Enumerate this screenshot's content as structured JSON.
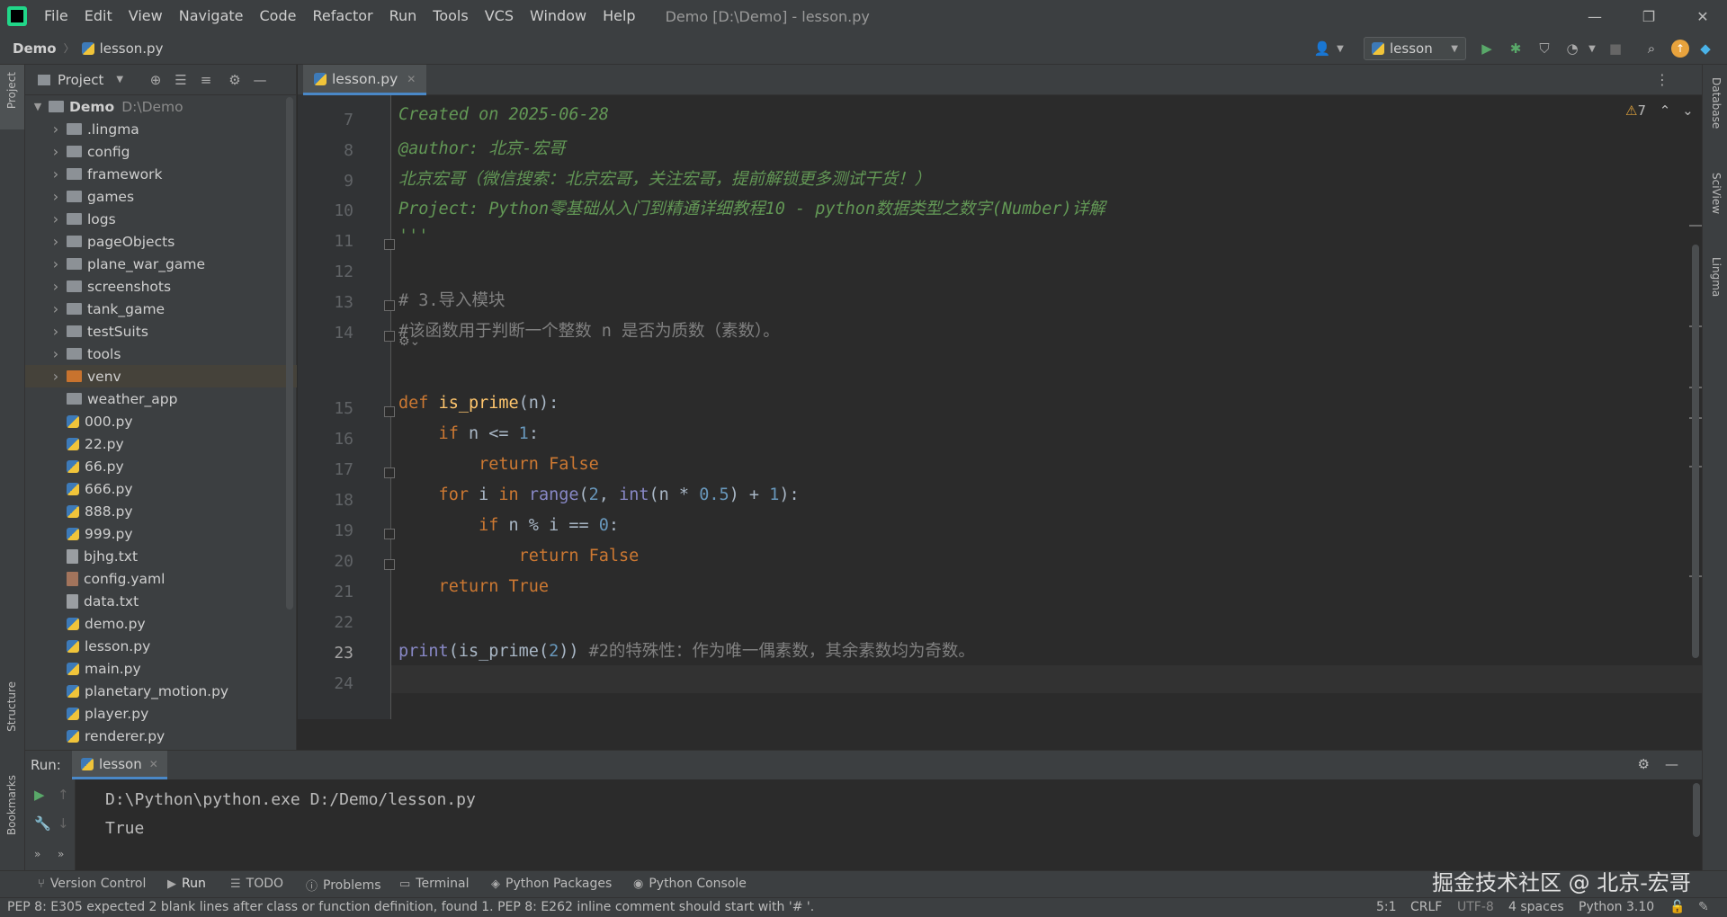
{
  "menubar": {
    "items": [
      "File",
      "Edit",
      "View",
      "Navigate",
      "Code",
      "Refactor",
      "Run",
      "Tools",
      "VCS",
      "Window",
      "Help"
    ],
    "window_title": "Demo [D:\\Demo] - lesson.py"
  },
  "navbar": {
    "crumb_project": "Demo",
    "crumb_file": "lesson.py",
    "run_config": "lesson"
  },
  "left_strip": {
    "project": "Project",
    "structure": "Structure",
    "bookmarks": "Bookmarks"
  },
  "right_strip": {
    "database": "Database",
    "sciview": "SciView",
    "lingma": "Lingma"
  },
  "project_panel": {
    "title": "Project",
    "root_name": "Demo",
    "root_path": "D:\\Demo",
    "items": [
      {
        "name": ".lingma",
        "kind": "folder"
      },
      {
        "name": "config",
        "kind": "folder"
      },
      {
        "name": "framework",
        "kind": "folder"
      },
      {
        "name": "games",
        "kind": "folder"
      },
      {
        "name": "logs",
        "kind": "folder"
      },
      {
        "name": "pageObjects",
        "kind": "folder"
      },
      {
        "name": "plane_war_game",
        "kind": "folder"
      },
      {
        "name": "screenshots",
        "kind": "folder"
      },
      {
        "name": "tank_game",
        "kind": "folder"
      },
      {
        "name": "testSuits",
        "kind": "folder"
      },
      {
        "name": "tools",
        "kind": "folder"
      },
      {
        "name": "venv",
        "kind": "folder-orange"
      },
      {
        "name": "weather_app",
        "kind": "folder-plain"
      },
      {
        "name": "000.py",
        "kind": "py"
      },
      {
        "name": "22.py",
        "kind": "py"
      },
      {
        "name": "66.py",
        "kind": "py"
      },
      {
        "name": "666.py",
        "kind": "py"
      },
      {
        "name": "888.py",
        "kind": "py"
      },
      {
        "name": "999.py",
        "kind": "py"
      },
      {
        "name": "bjhg.txt",
        "kind": "txt"
      },
      {
        "name": "config.yaml",
        "kind": "yml"
      },
      {
        "name": "data.txt",
        "kind": "txt"
      },
      {
        "name": "demo.py",
        "kind": "py"
      },
      {
        "name": "lesson.py",
        "kind": "py"
      },
      {
        "name": "main.py",
        "kind": "py"
      },
      {
        "name": "planetary_motion.py",
        "kind": "py"
      },
      {
        "name": "player.py",
        "kind": "py"
      },
      {
        "name": "renderer.py",
        "kind": "py"
      }
    ]
  },
  "editor": {
    "tab_label": "lesson.py",
    "warning_count": "7",
    "lines": [
      {
        "n": "7",
        "text": "Created on 2025-06-28"
      },
      {
        "n": "8",
        "text": "@author: 北京-宏哥"
      },
      {
        "n": "9",
        "text": "北京宏哥（微信搜索：北京宏哥，关注宏哥，提前解锁更多测试干货！）"
      },
      {
        "n": "10",
        "text": "Project: Python零基础从入门到精通详细教程10 - python数据类型之数字(Number)详解"
      },
      {
        "n": "11",
        "text": "'''"
      },
      {
        "n": "12",
        "text": ""
      },
      {
        "n": "13",
        "text": "# 3.导入模块"
      },
      {
        "n": "14",
        "text": "#该函数用于判断一个整数 n 是否为质数（素数）。"
      },
      {
        "n": "15",
        "k1": "def ",
        "f1": "is_prime",
        "r1": "(n):"
      },
      {
        "n": "16",
        "k1": "    if ",
        "r1": "n <= ",
        "v1": "1",
        "r2": ":"
      },
      {
        "n": "17",
        "k1": "        return False"
      },
      {
        "n": "18",
        "k1": "    for ",
        "r1": "i ",
        "k2": "in ",
        "b1": "range",
        "r2": "(",
        "v1": "2",
        "r3": ", ",
        "b2": "int",
        "r4": "(n * ",
        "v2": "0.5",
        "r5": ") + ",
        "v3": "1",
        "r6": "):"
      },
      {
        "n": "19",
        "k1": "        if ",
        "r1": "n % i == ",
        "v1": "0",
        "r2": ":"
      },
      {
        "n": "20",
        "k1": "            return False"
      },
      {
        "n": "21",
        "k1": "    return True"
      },
      {
        "n": "22",
        "text": ""
      },
      {
        "n": "23",
        "b1": "print",
        "r1": "(is_prime(",
        "v1": "2",
        "r2": ")) ",
        "c1": "#2的特殊性：作为唯一偶素数，其余素数均为奇数。"
      },
      {
        "n": "24",
        "text": ""
      }
    ]
  },
  "run_panel": {
    "label": "Run:",
    "tab": "lesson",
    "output": [
      "D:\\Python\\python.exe D:/Demo/lesson.py",
      "True"
    ]
  },
  "bottom_tabs": [
    "Version Control",
    "Run",
    "TODO",
    "Problems",
    "Terminal",
    "Python Packages",
    "Python Console"
  ],
  "status": {
    "message": "PEP 8: E305 expected 2 blank lines after class or function definition, found 1. PEP 8: E262 inline comment should start with '# '.",
    "position": "5:1",
    "line_sep": "CRLF",
    "encoding": "UTF-8",
    "indent": "4 spaces",
    "interpreter": "Python 3.10"
  },
  "watermark": "掘金技术社区 @ 北京-宏哥"
}
